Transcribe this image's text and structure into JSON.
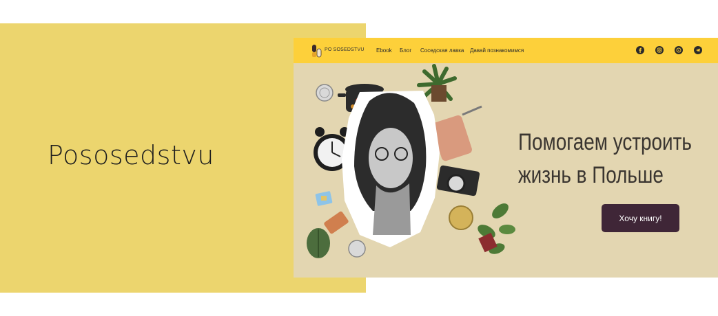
{
  "brand": {
    "title": "Pososedstvu"
  },
  "site": {
    "logo_text": "PO SOSEDSTVU",
    "nav": [
      "Ebook",
      "Блог",
      "Соседская лавка",
      "Давай познакомимся"
    ],
    "social_icons": [
      "facebook-icon",
      "instagram-icon",
      "whatsapp-icon",
      "telegram-icon"
    ],
    "hero": {
      "headline_line1": "Помогаем устроить",
      "headline_line2": "жизнь в Польше",
      "cta_label": "Хочу книгу!"
    }
  },
  "colors": {
    "page_yellow": "#ecd56e",
    "header_yellow": "#fdd03a",
    "hero_background": "#e3d6b1",
    "button": "#3f2637"
  }
}
